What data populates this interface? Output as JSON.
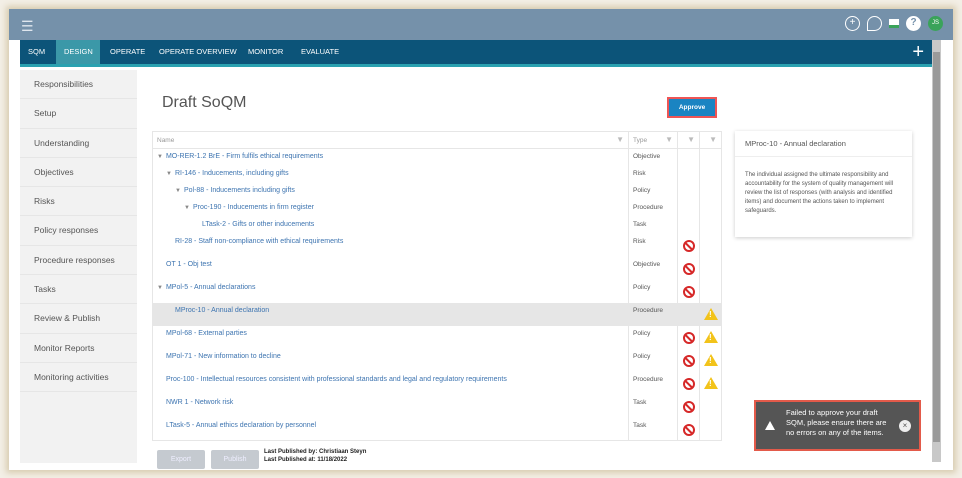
{
  "topbar": {
    "menu_icon": "hamburger-icon",
    "icons": [
      "add-icon",
      "search-icon",
      "chat-icon",
      "help-icon"
    ],
    "avatar": "JS"
  },
  "nav": {
    "tabs": [
      "SQM",
      "DESIGN",
      "OPERATE",
      "OPERATE OVERVIEW",
      "MONITOR",
      "EVALUATE"
    ],
    "active": "DESIGN",
    "plus": "+"
  },
  "sidebar": {
    "items": [
      "Responsibilities",
      "Setup",
      "Understanding",
      "Objectives",
      "Risks",
      "Policy responses",
      "Procedure responses",
      "Tasks",
      "Review & Publish",
      "Monitor Reports",
      "Monitoring activities"
    ]
  },
  "main": {
    "title": "Draft SoQM",
    "approve": "Approve",
    "columns": {
      "name": "Name",
      "type": "Type"
    },
    "rows": [
      {
        "name": "MO-RER-1.2 BrE - Firm fulfils ethical requirements",
        "type": "Objective",
        "level": 0,
        "caret": true,
        "error": false,
        "warning": false
      },
      {
        "name": "RI-146 - Inducements, including gifts",
        "type": "Risk",
        "level": 1,
        "caret": true,
        "error": false,
        "warning": false
      },
      {
        "name": "Pol-88 - Inducements including gifts",
        "type": "Policy",
        "level": 2,
        "caret": true,
        "error": false,
        "warning": false
      },
      {
        "name": "Proc-190 - Inducements in firm register",
        "type": "Procedure",
        "level": 3,
        "caret": true,
        "error": false,
        "warning": false
      },
      {
        "name": "LTask-2 - Gifts or other inducements",
        "type": "Task",
        "level": 4,
        "caret": false,
        "error": false,
        "warning": false
      },
      {
        "name": "RI-28 - Staff non-compliance with ethical requirements",
        "type": "Risk",
        "level": 1,
        "caret": false,
        "error": true,
        "warning": false
      },
      {
        "name": "OT 1 - Obj test",
        "type": "Objective",
        "level": 0,
        "caret": false,
        "error": true,
        "warning": false
      },
      {
        "name": "MPol-5 - Annual declarations",
        "type": "Policy",
        "level": 0,
        "caret": true,
        "error": true,
        "warning": false
      },
      {
        "name": "MProc-10 - Annual declaration",
        "type": "Procedure",
        "level": 1,
        "caret": false,
        "error": false,
        "warning": true,
        "selected": true
      },
      {
        "name": "MPol-68 - External parties",
        "type": "Policy",
        "level": 0,
        "caret": false,
        "error": true,
        "warning": true
      },
      {
        "name": "MPol-71 - New information to decline",
        "type": "Policy",
        "level": 0,
        "caret": false,
        "error": true,
        "warning": true
      },
      {
        "name": "Proc-100 - Intellectual resources consistent with professional standards and legal and regulatory requirements",
        "type": "Procedure",
        "level": 0,
        "caret": false,
        "error": true,
        "warning": true
      },
      {
        "name": "NWR 1 - Network risk",
        "type": "Task",
        "level": 0,
        "caret": false,
        "error": true,
        "warning": false
      },
      {
        "name": "LTask-5 - Annual ethics declaration by personnel",
        "type": "Task",
        "level": 0,
        "caret": false,
        "error": true,
        "warning": false
      }
    ],
    "export": "Export",
    "publish": "Publish",
    "last_published_by": "Last Published by: Christiaan Steyn",
    "last_published_at": "Last Published at: 11/18/2022"
  },
  "panel": {
    "title": "MProc-10 - Annual declaration",
    "description": "The individual assigned the ultimate responsibility and accountability for the system of quality management will review the list of responses (with analysis and identified items) and document the actions taken to implement safeguards."
  },
  "toast": {
    "message": "Failed to approve your draft SQM, please ensure there are no errors on any of the items.",
    "close": "×"
  },
  "colors": {
    "nav": "#0c5479",
    "accent": "#1a84c2",
    "error": "#d62828",
    "warning": "#f2c31a"
  }
}
